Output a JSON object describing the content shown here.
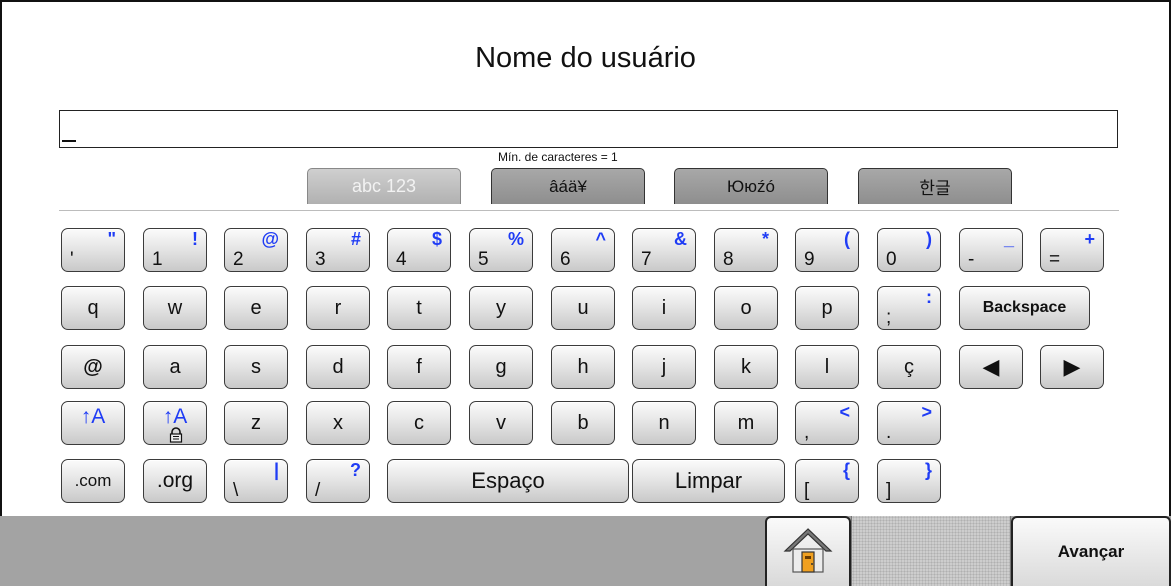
{
  "header": {
    "title": "Nome do usuário"
  },
  "input": {
    "value": "",
    "min_chars_label": "Mín. de caracteres = 1"
  },
  "tabs": [
    {
      "label": "abc 123",
      "active": true
    },
    {
      "label": "âáä¥",
      "active": false
    },
    {
      "label": "Ююźó",
      "active": false
    },
    {
      "label": "한글",
      "active": false
    }
  ],
  "keyboard": {
    "row1": [
      {
        "p": "'",
        "s": "\""
      },
      {
        "p": "1",
        "s": "!"
      },
      {
        "p": "2",
        "s": "@"
      },
      {
        "p": "3",
        "s": "#"
      },
      {
        "p": "4",
        "s": "$"
      },
      {
        "p": "5",
        "s": "%"
      },
      {
        "p": "6",
        "s": "^"
      },
      {
        "p": "7",
        "s": "&"
      },
      {
        "p": "8",
        "s": "*"
      },
      {
        "p": "9",
        "s": "("
      },
      {
        "p": "0",
        "s": ")"
      },
      {
        "p": "-",
        "s": "_"
      },
      {
        "p": "=",
        "s": "+"
      }
    ],
    "row2": [
      {
        "c": "q"
      },
      {
        "c": "w"
      },
      {
        "c": "e"
      },
      {
        "c": "r"
      },
      {
        "c": "t"
      },
      {
        "c": "y"
      },
      {
        "c": "u"
      },
      {
        "c": "i"
      },
      {
        "c": "o"
      },
      {
        "c": "p"
      },
      {
        "p": ";",
        "s": ":"
      }
    ],
    "backspace": "Backspace",
    "row3": [
      {
        "c": "@"
      },
      {
        "c": "a"
      },
      {
        "c": "s"
      },
      {
        "c": "d"
      },
      {
        "c": "f"
      },
      {
        "c": "g"
      },
      {
        "c": "h"
      },
      {
        "c": "j"
      },
      {
        "c": "k"
      },
      {
        "c": "l"
      },
      {
        "c": "ç"
      }
    ],
    "arrow_left": "◀",
    "arrow_right": "▶",
    "row4": [
      {
        "c": "z"
      },
      {
        "c": "x"
      },
      {
        "c": "c"
      },
      {
        "c": "v"
      },
      {
        "c": "b"
      },
      {
        "c": "n"
      },
      {
        "c": "m"
      },
      {
        "p": ",",
        "s": "<"
      },
      {
        "p": ".",
        "s": ">"
      }
    ],
    "shift_label": "↑A",
    "caps_lock_label": "↑A",
    "row5": {
      "com": ".com",
      "org": ".org",
      "backslash": {
        "p": "\\",
        "s": "|"
      },
      "slash": {
        "p": "/",
        "s": "?"
      },
      "space": "Espaço",
      "clear": "Limpar",
      "lbracket": {
        "p": "[",
        "s": "{"
      },
      "rbracket": {
        "p": "]",
        "s": "}"
      }
    }
  },
  "footer": {
    "home_icon": "home-icon",
    "next_label": "Avançar"
  },
  "colors": {
    "accent_blue": "#1f3cf5",
    "bar_gray": "#a3a3a3",
    "door_orange": "#f0a020"
  }
}
